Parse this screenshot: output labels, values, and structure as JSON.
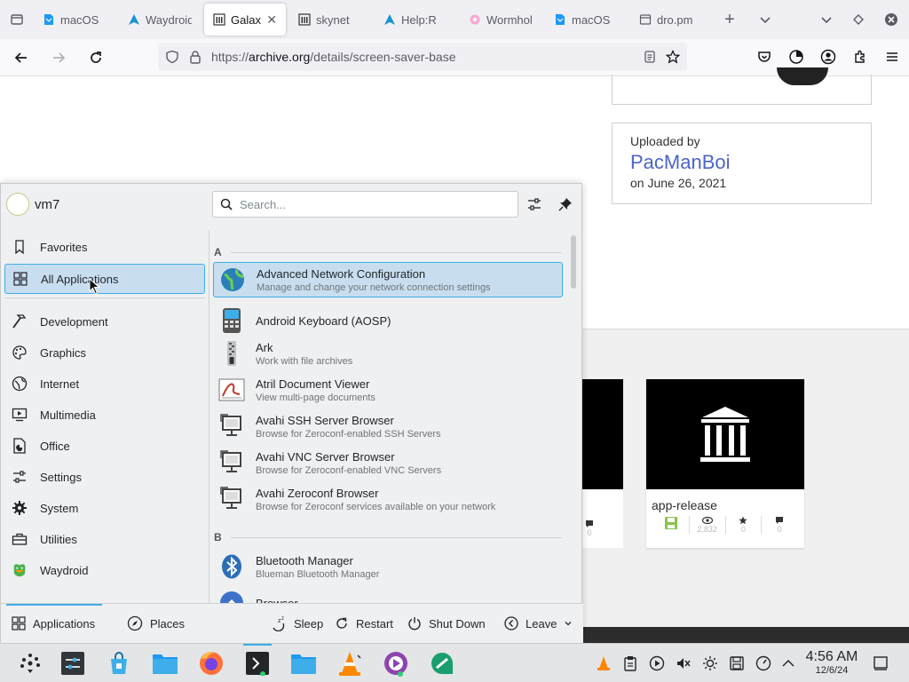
{
  "browser": {
    "tabs": [
      {
        "label": "macOS",
        "icon": "kde-doc-icon"
      },
      {
        "label": "Waydroid",
        "icon": "arch-icon"
      },
      {
        "label": "Galaxy",
        "icon": "archive-icon",
        "active": true
      },
      {
        "label": "skynet",
        "icon": "archive-icon"
      },
      {
        "label": "Help:R",
        "icon": "arch-icon"
      },
      {
        "label": "Wormhole",
        "icon": "flower-icon"
      },
      {
        "label": "macOS",
        "icon": "kde-doc-icon"
      },
      {
        "label": "dro.pm",
        "icon": "page-icon"
      }
    ],
    "url_prefix": "https://",
    "url_domain": "archive.org",
    "url_path": "/details/screen-saver-base"
  },
  "page": {
    "uploaded_by_label": "Uploaded by",
    "uploader": "PacManBoi",
    "upload_date": "on June 26, 2021",
    "tile": {
      "title": "app-release",
      "views": "2,832",
      "favorites": "0",
      "reviews": "0"
    },
    "partial_tile": {
      "reviews": "0"
    }
  },
  "launcher": {
    "user": "vm7",
    "search_placeholder": "Search...",
    "categories": [
      {
        "label": "Favorites",
        "icon": "bookmark-icon"
      },
      {
        "label": "All Applications",
        "icon": "grid-icon",
        "selected": true
      },
      {
        "label": "Development",
        "icon": "hammer-icon"
      },
      {
        "label": "Graphics",
        "icon": "palette-icon"
      },
      {
        "label": "Internet",
        "icon": "globe-icon"
      },
      {
        "label": "Multimedia",
        "icon": "monitor-icon"
      },
      {
        "label": "Office",
        "icon": "document-icon"
      },
      {
        "label": "Settings",
        "icon": "sliders-icon"
      },
      {
        "label": "System",
        "icon": "gear-icon"
      },
      {
        "label": "Utilities",
        "icon": "toolbox-icon"
      },
      {
        "label": "Waydroid",
        "icon": "waydroid-icon"
      }
    ],
    "sections": [
      "A",
      "B"
    ],
    "apps": [
      {
        "name": "Advanced Network Configuration",
        "desc": "Manage and change your network connection settings",
        "icon": "network-globe-icon",
        "selected": true
      },
      {
        "name": "Android Keyboard (AOSP)",
        "desc": "",
        "icon": "keyboard-icon"
      },
      {
        "name": "Ark",
        "desc": "Work with file archives",
        "icon": "zipper-icon"
      },
      {
        "name": "Atril Document Viewer",
        "desc": "View multi-page documents",
        "icon": "atril-icon"
      },
      {
        "name": "Avahi SSH Server Browser",
        "desc": "Browse for Zeroconf-enabled SSH Servers",
        "icon": "network-computer-icon"
      },
      {
        "name": "Avahi VNC Server Browser",
        "desc": "Browse for Zeroconf-enabled VNC Servers",
        "icon": "network-computer-icon"
      },
      {
        "name": "Avahi Zeroconf Browser",
        "desc": "Browse for Zeroconf services available on your network",
        "icon": "network-computer-icon"
      },
      {
        "name": "Bluetooth Manager",
        "desc": "Blueman Bluetooth Manager",
        "icon": "bluetooth-icon"
      },
      {
        "name": "Browser",
        "desc": "",
        "icon": "browser-icon"
      }
    ],
    "footer": {
      "applications": "Applications",
      "places": "Places",
      "sleep": "Sleep",
      "restart": "Restart",
      "shutdown": "Shut Down",
      "leave": "Leave"
    }
  },
  "taskbar": {
    "time": "4:56 AM",
    "date": "12/6/24"
  },
  "colors": {
    "accent": "#3daee9",
    "selection": "#c8def0",
    "link": "#4b64c8"
  }
}
